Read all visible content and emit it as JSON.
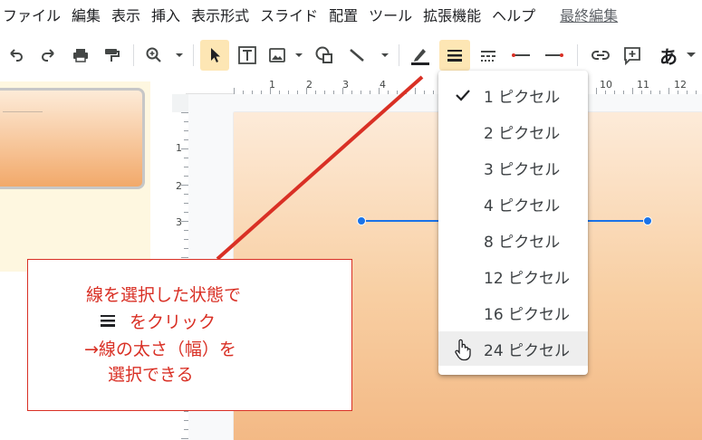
{
  "menu": {
    "items": [
      "ファイル",
      "編集",
      "表示",
      "挿入",
      "表示形式",
      "スライド",
      "配置",
      "ツール",
      "拡張機能",
      "ヘルプ"
    ],
    "last_edit": "最終編集"
  },
  "toolbar": {
    "text_style_label": "あ",
    "active_tool": "line-weight"
  },
  "ruler": {
    "top_numbers": [
      "1",
      "2",
      "3",
      "4",
      "10",
      "11",
      "12"
    ],
    "left_numbers": [
      "1",
      "2",
      "3"
    ]
  },
  "weight_menu": {
    "selected": "1 ピクセル",
    "hovered": "24 ピクセル",
    "options": [
      "1 ピクセル",
      "2 ピクセル",
      "3 ピクセル",
      "4 ピクセル",
      "8 ピクセル",
      "12 ピクセル",
      "16 ピクセル",
      "24 ピクセル"
    ]
  },
  "annotation": {
    "line1": "線を選択した状態で",
    "line2": "をクリック",
    "line3": "→線の太さ（幅）を",
    "line4": "選択できる"
  },
  "colors": {
    "accent_red": "#d93025",
    "selection_blue": "#1a73e8",
    "active_tool_bg": "#fde6b4",
    "slide_top": "#fdebd9",
    "slide_bottom": "#f3b985"
  }
}
